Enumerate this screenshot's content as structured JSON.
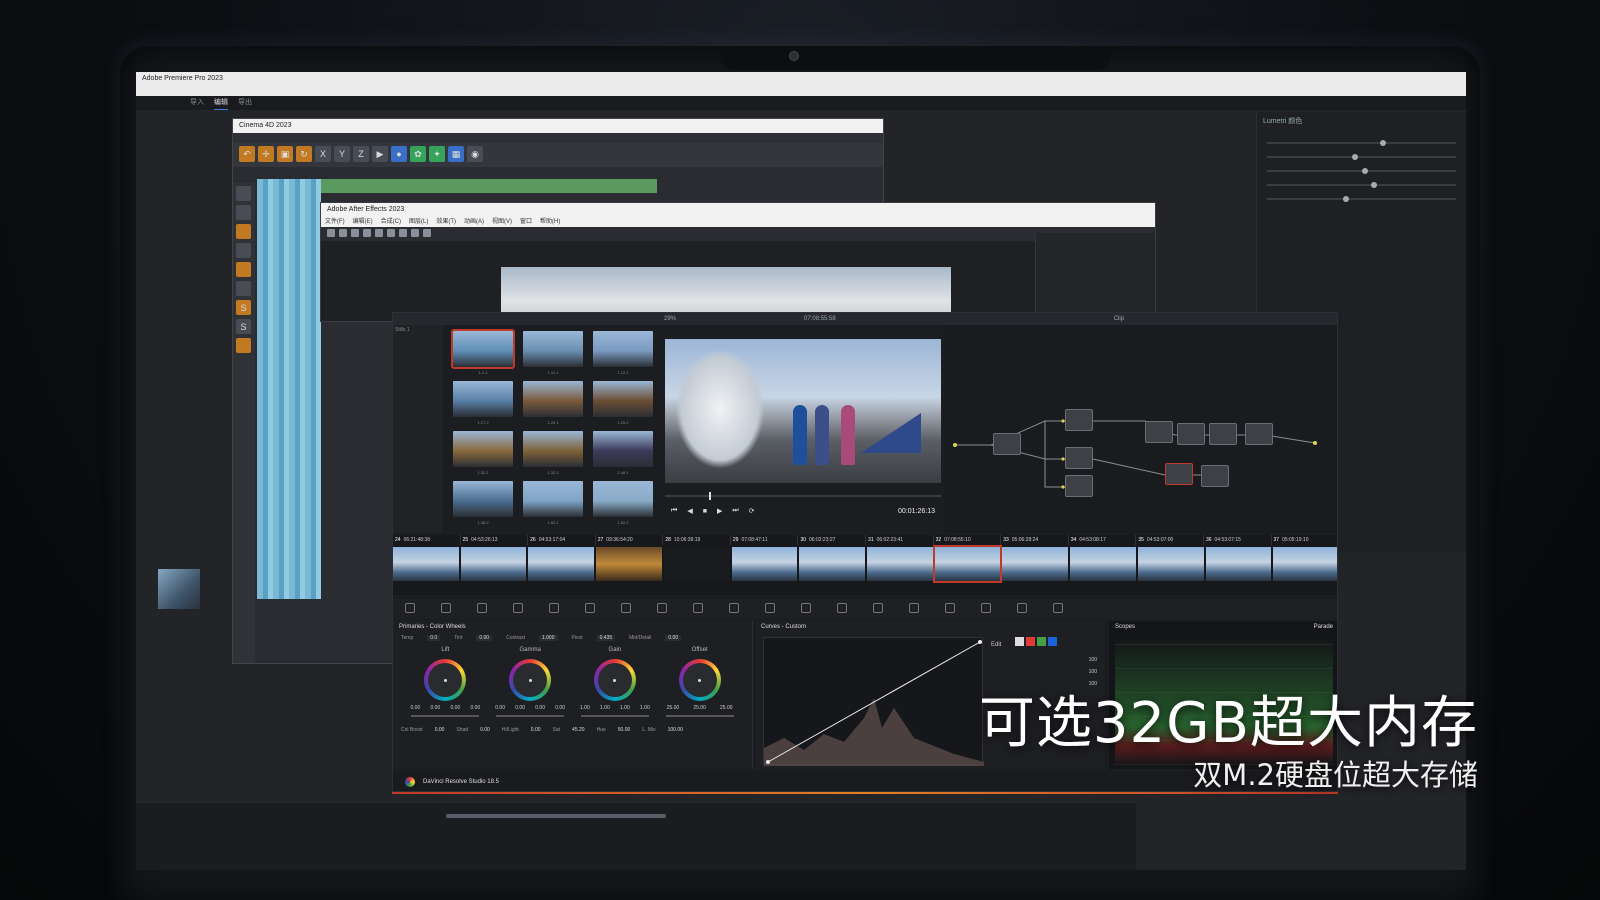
{
  "premiere": {
    "title": "Adobe Premiere Pro 2023",
    "tabs": [
      "导入",
      "编辑",
      "导出"
    ],
    "active_tab": "编辑",
    "panel_title": "Lumetri 颜色"
  },
  "cinema4d": {
    "title": "Cinema 4D 2023",
    "toolbar_axes": [
      "X",
      "Y",
      "Z"
    ]
  },
  "aftereffects": {
    "title": "Adobe After Effects 2023",
    "menu": [
      "文件(F)",
      "编辑(E)",
      "合成(C)",
      "图层(L)",
      "效果(T)",
      "动画(A)",
      "视图(V)",
      "窗口",
      "帮助(H)"
    ]
  },
  "resolve": {
    "zoom": "29%",
    "viewer_timecode": "07:08:55:58",
    "playhead_timecode": "00:01:26:13",
    "node_panel_label": "Clip",
    "stills_label": "Stills 1",
    "gallery": [
      {
        "label": "1.1.1",
        "color": "#5f8fb8"
      },
      {
        "label": "1.11.1",
        "color": "#6a8fb0"
      },
      {
        "label": "1.12.1",
        "color": "#7a9ac0"
      },
      {
        "label": "1.17.2",
        "color": "#587fa6"
      },
      {
        "label": "1.25.1",
        "color": "#7b5a3a"
      },
      {
        "label": "1.25.2",
        "color": "#6b4e34"
      },
      {
        "label": "1.32.1",
        "color": "#8a6a3e"
      },
      {
        "label": "1.32.2",
        "color": "#7e623a"
      },
      {
        "label": "1.48.1",
        "color": "#3e3a5a"
      },
      {
        "label": "1.48.2",
        "color": "#4a6e92"
      },
      {
        "label": "1.52.1",
        "color": "#7fa4c6"
      },
      {
        "label": "1.52.2",
        "color": "#8aacc9"
      }
    ],
    "clips": [
      {
        "num": "24",
        "tc": "06:21:48:38"
      },
      {
        "num": "25",
        "tc": "04:53:26:13"
      },
      {
        "num": "26",
        "tc": "04:53:17:04"
      },
      {
        "num": "27",
        "tc": "09:36:54:20"
      },
      {
        "num": "28",
        "tc": "10:06:39:19"
      },
      {
        "num": "29",
        "tc": "07:08:47:11"
      },
      {
        "num": "30",
        "tc": "06:02:23:27"
      },
      {
        "num": "31",
        "tc": "06:02:23:41"
      },
      {
        "num": "32",
        "tc": "07:08:55:10"
      },
      {
        "num": "33",
        "tc": "05:06:28:24"
      },
      {
        "num": "34",
        "tc": "04:53:08:17"
      },
      {
        "num": "35",
        "tc": "04:53:07:00"
      },
      {
        "num": "36",
        "tc": "04:53:07:15"
      },
      {
        "num": "37",
        "tc": "05:05:19:10"
      }
    ],
    "primaries": {
      "title": "Primaries - Color Wheels",
      "temp_label": "Temp",
      "temp": "0.0",
      "tint_label": "Tint",
      "tint": "0.00",
      "contrast_label": "Contrast",
      "contrast": "1.000",
      "pivot_label": "Pivot",
      "pivot": "0.435",
      "middetail_label": "Mid/Detail",
      "middetail": "0.00",
      "wheels": [
        {
          "name": "Lift",
          "vals": [
            "0.00",
            "0.00",
            "0.00",
            "0.00"
          ]
        },
        {
          "name": "Gamma",
          "vals": [
            "0.00",
            "0.00",
            "0.00",
            "0.00"
          ]
        },
        {
          "name": "Gain",
          "vals": [
            "1.00",
            "1.00",
            "1.00",
            "1.00"
          ]
        },
        {
          "name": "Offset",
          "vals": [
            "25.00",
            "25.00",
            "25.00"
          ]
        }
      ],
      "colboost_label": "Col Boost",
      "colboost": "0.00",
      "shad_label": "Shad",
      "shad": "0.00",
      "hilight_label": "Hi/Light",
      "hilight": "0.00",
      "sat_label": "Sat",
      "sat": "45.20",
      "hue_label": "Hue",
      "hue": "50.00",
      "lmix_label": "L. Mix",
      "lmix": "100.00"
    },
    "curves_title": "Curves - Custom",
    "curves_edit": "Edit",
    "curves_vals": [
      "100",
      "100",
      "100"
    ],
    "scopes_title": "Scopes",
    "scopes_mode": "Parade",
    "footer": "DaVinci Resolve Studio 18.5"
  },
  "overlay": {
    "headline": "可选32GB超大内存",
    "subline": "双M.2硬盘位超大存储"
  }
}
